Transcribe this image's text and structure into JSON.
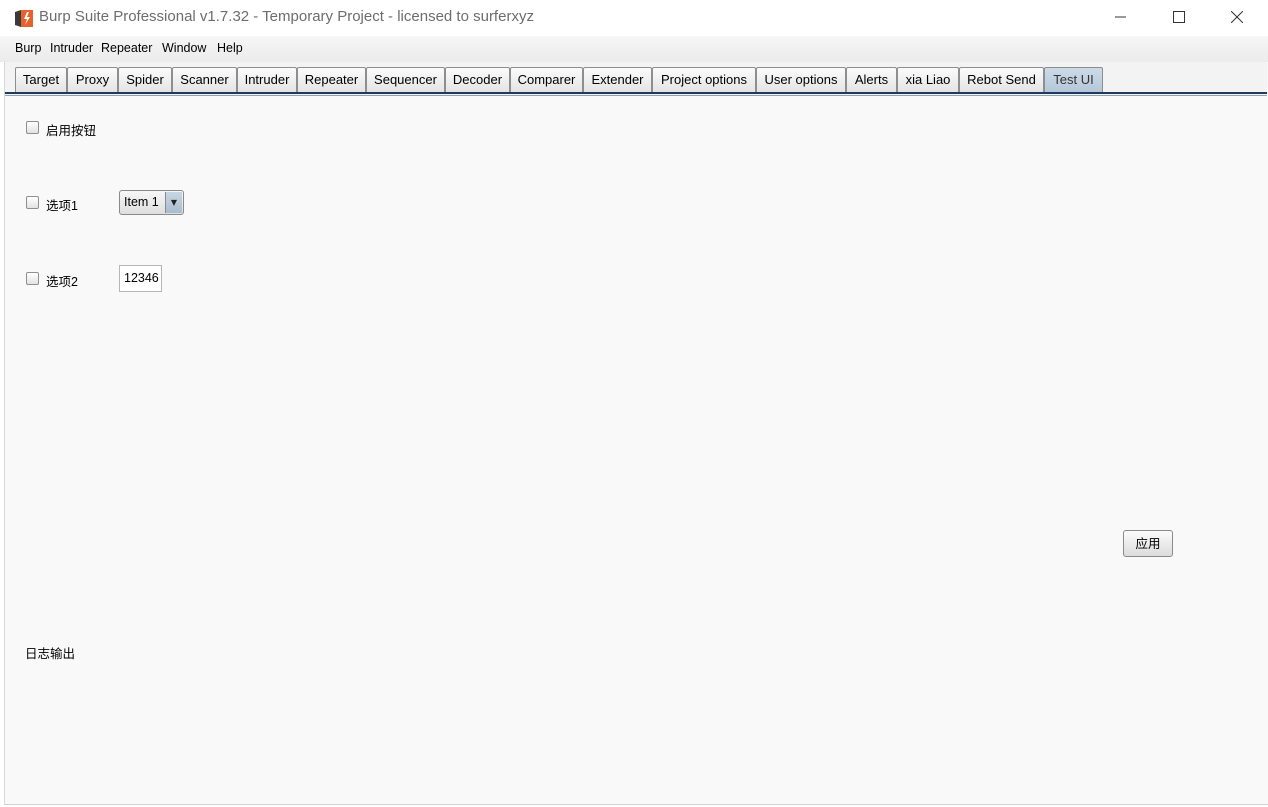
{
  "window": {
    "title": "Burp Suite Professional v1.7.32 - Temporary Project - licensed to surferxyz"
  },
  "menu": [
    "Burp",
    "Intruder",
    "Repeater",
    "Window",
    "Help"
  ],
  "tabs": [
    "Target",
    "Proxy",
    "Spider",
    "Scanner",
    "Intruder",
    "Repeater",
    "Sequencer",
    "Decoder",
    "Comparer",
    "Extender",
    "Project options",
    "User options",
    "Alerts",
    "xia Liao",
    "Rebot Send",
    "Test UI"
  ],
  "active_tab": "Test UI",
  "panel": {
    "enable_label": "启用按钮",
    "option1_label": "选项1",
    "option1_select": "Item 1",
    "option2_label": "选项2",
    "option2_value": "12346",
    "apply_label": "应用",
    "log_label": "日志输出"
  },
  "colors": {
    "accent": "#1f3a5a",
    "active_tab": "#b4c7d8",
    "icon_orange": "#e8602c"
  }
}
